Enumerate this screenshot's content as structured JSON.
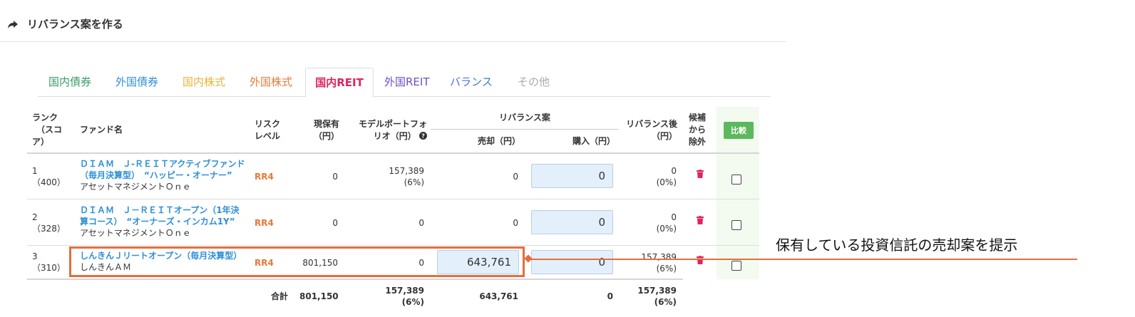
{
  "header": {
    "title": "リバランス案を作る",
    "icon": "share-arrow-icon"
  },
  "tabs": [
    {
      "label": "国内債券",
      "color": "#3a9b6a"
    },
    {
      "label": "外国債券",
      "color": "#2f8fd8"
    },
    {
      "label": "国内株式",
      "color": "#e9b43a"
    },
    {
      "label": "外国株式",
      "color": "#e8793b"
    },
    {
      "label": "国内REIT",
      "color": "#e0245e",
      "active": true
    },
    {
      "label": "外国REIT",
      "color": "#6f4fc1"
    },
    {
      "label": "バランス",
      "color": "#3f78d1"
    },
    {
      "label": "その他",
      "color": "#aaaaaa"
    }
  ],
  "table": {
    "headers": {
      "rank": [
        "ランク",
        "（スコ",
        "ア）"
      ],
      "fund": "ファンド名",
      "risk": [
        "リスク",
        "レベル"
      ],
      "holding": [
        "現保有",
        "（円）"
      ],
      "model": [
        "モデルポートフォ",
        "リオ（円）"
      ],
      "rebalance": "リバランス案",
      "sell": "売却（円）",
      "buy": "購入（円）",
      "after": [
        "リバランス後",
        "（円）"
      ],
      "exclude": [
        "候補",
        "から",
        "除外"
      ],
      "compare_button": "比較"
    },
    "rows": [
      {
        "rank": "1",
        "score": "（400）",
        "fund_line1": "ＤＩＡＭ　Ｊ-ＲＥＩＴアクティブファンド",
        "fund_line2": "（毎月決算型）　“ハッピー・オーナー”",
        "company": "アセットマネジメントＯｎｅ",
        "risk": "RR4",
        "holding": "0",
        "model": "157,389",
        "model_pct": "(6%)",
        "sell": "0",
        "buy": "0",
        "after": "0",
        "after_pct": "(0%)"
      },
      {
        "rank": "2",
        "score": "（328）",
        "fund_line1": "ＤＩＡＭ　Ｊ－ＲＥＩＴオープン（1年決",
        "fund_line2": "算コース）　“オーナーズ・インカム1Y”",
        "company": "アセットマネジメントＯｎｅ",
        "risk": "RR4",
        "holding": "0",
        "model": "0",
        "model_pct": "",
        "sell": "0",
        "buy": "0",
        "after": "0",
        "after_pct": "(0%)"
      },
      {
        "rank": "3",
        "score": "（310）",
        "fund_line1": "しんきんＪリートオープン（毎月決算型）",
        "fund_line2": "",
        "company": "しんきんＡＭ",
        "risk": "RR4",
        "holding": "801,150",
        "model": "0",
        "model_pct": "",
        "sell": "643,761",
        "buy": "0",
        "after": "157,389",
        "after_pct": "(6%)"
      }
    ],
    "total": {
      "label": "合計",
      "holding": "801,150",
      "model": "157,389",
      "model_pct": "(6%)",
      "sell": "643,761",
      "buy": "0",
      "after": "157,389",
      "after_pct": "(6%)"
    }
  },
  "annotation": {
    "text": "保有している投資信託の売却案を提示",
    "color": "#e0703f"
  }
}
